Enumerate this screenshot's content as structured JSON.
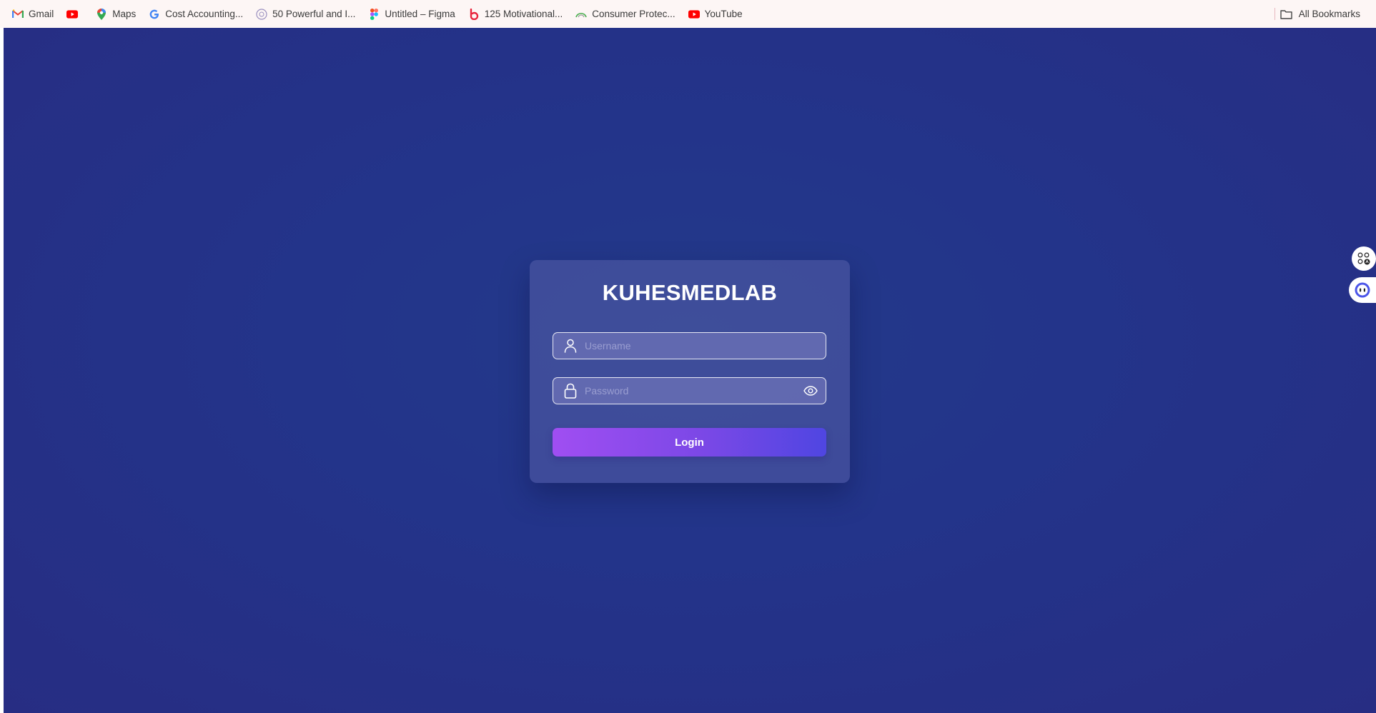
{
  "bookmarks": {
    "items": [
      {
        "label": "Gmail",
        "icon": "gmail-icon"
      },
      {
        "label": "",
        "icon": "youtube-icon"
      },
      {
        "label": "Maps",
        "icon": "maps-pin-icon"
      },
      {
        "label": "Cost Accounting...",
        "icon": "google-g-icon"
      },
      {
        "label": "50 Powerful and I...",
        "icon": "circle-site-icon"
      },
      {
        "label": "Untitled – Figma",
        "icon": "figma-icon"
      },
      {
        "label": "125 Motivational...",
        "icon": "b-logo-icon"
      },
      {
        "label": "Consumer Protec...",
        "icon": "arc-site-icon"
      },
      {
        "label": "YouTube",
        "icon": "youtube-icon"
      }
    ],
    "all_bookmarks_label": "All Bookmarks"
  },
  "login": {
    "title": "KUHESMEDLAB",
    "username_placeholder": "Username",
    "password_placeholder": "Password",
    "button_label": "Login"
  },
  "colors": {
    "background": "#23348a",
    "card": "#4a4f9e",
    "button_start": "#a04ef2",
    "button_end": "#4f46e2"
  }
}
